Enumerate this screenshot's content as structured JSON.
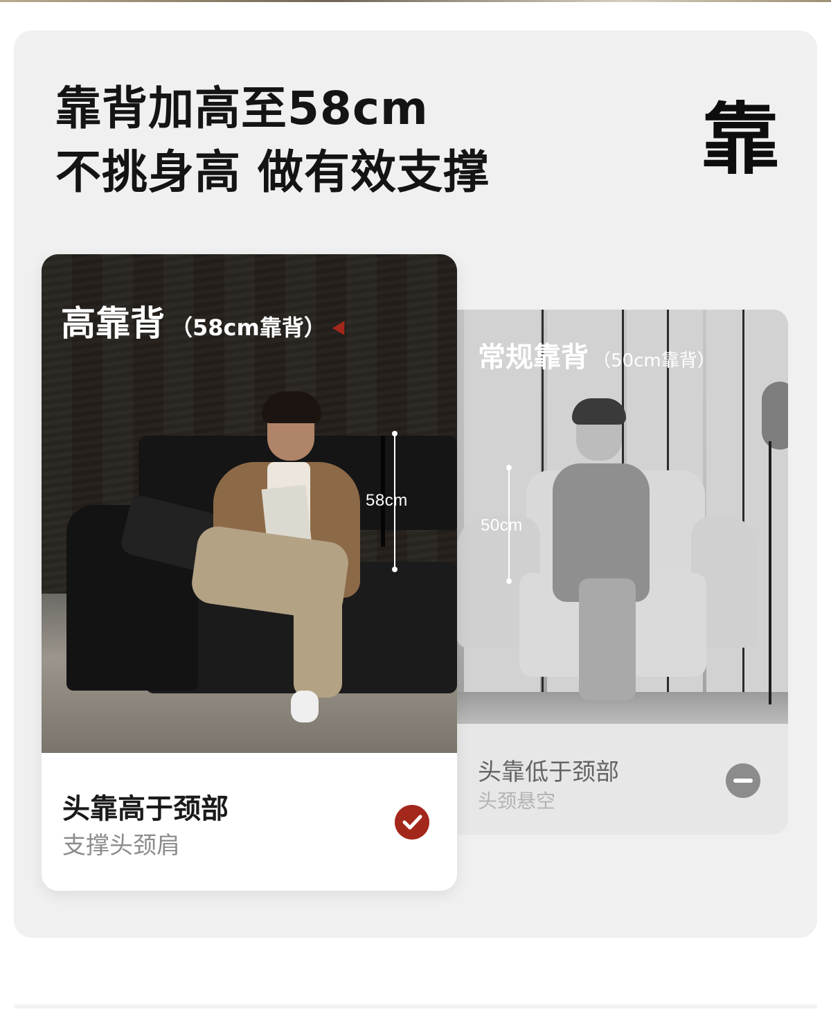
{
  "headline": {
    "line1": "靠背加高至58cm",
    "line2": "不挑身高 做有效支撑",
    "badge_char": "靠"
  },
  "high_back_card": {
    "title": "高靠背",
    "title_note": "（58cm靠背）",
    "dimension_label": "58cm",
    "caption_main": "头靠高于颈部",
    "caption_sub": "支撑头颈肩",
    "status_icon": "check-circle-icon",
    "accent_color": "#a3271b"
  },
  "regular_back_card": {
    "title": "常规靠背",
    "title_note": "（50cm靠背）",
    "dimension_label": "50cm",
    "caption_main": "头靠低于颈部",
    "caption_sub": "头颈悬空",
    "status_icon": "minus-circle-icon",
    "status_color": "#8c8c8c"
  }
}
